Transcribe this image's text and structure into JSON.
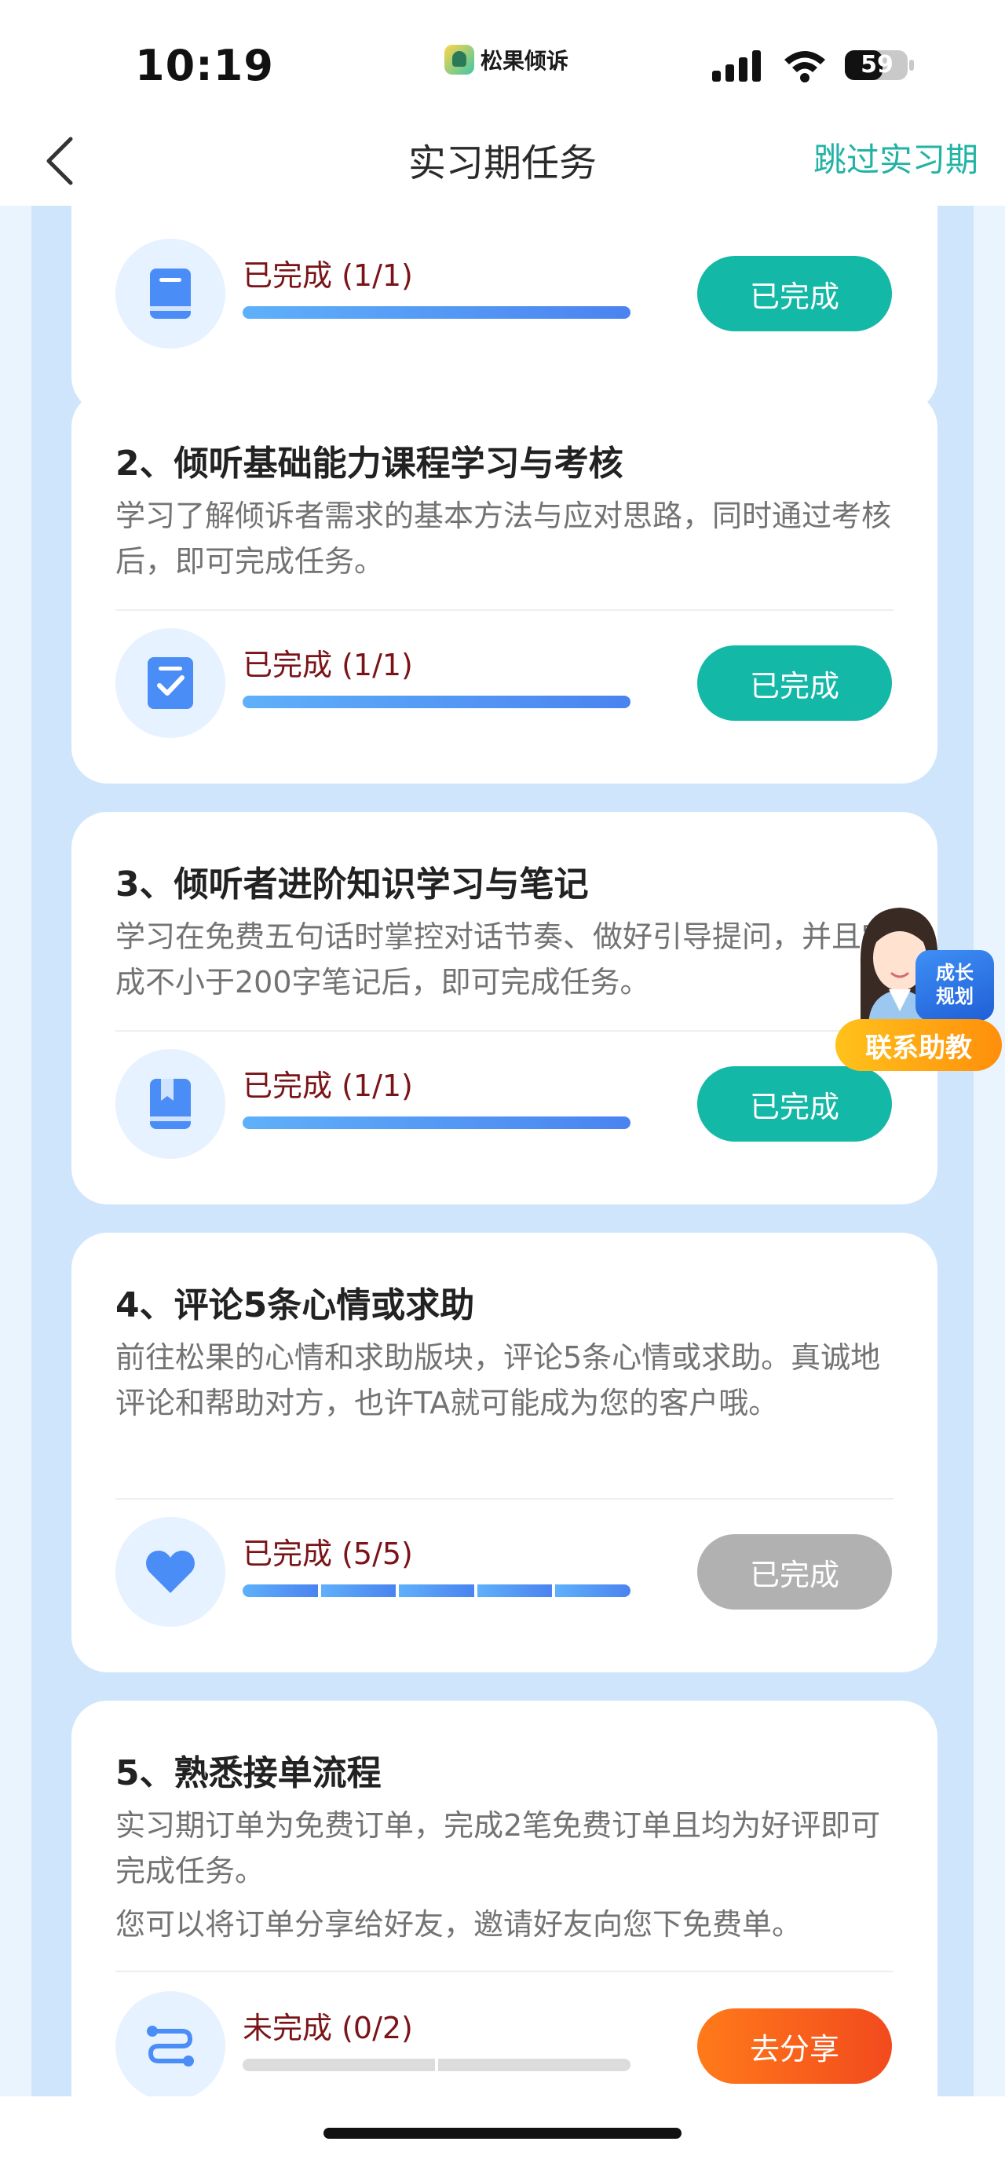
{
  "status_bar": {
    "time": "10:19",
    "brand": "松果倾诉",
    "battery": "59"
  },
  "nav": {
    "title": "实习期任务",
    "skip": "跳过实习期"
  },
  "tasks": [
    {
      "title": "",
      "description": [],
      "icon": "book-icon",
      "status": "已完成 (1/1)",
      "progress": 1,
      "button": "已完成",
      "button_style": "teal"
    },
    {
      "title": "2、倾听基础能力课程学习与考核",
      "description": [
        "学习了解倾诉者需求的基本方法与应对思路，同时通过考核后，即可完成任务。"
      ],
      "icon": "checklist-icon",
      "status": "已完成 (1/1)",
      "progress": 1,
      "button": "已完成",
      "button_style": "teal"
    },
    {
      "title": "3、倾听者进阶知识学习与笔记",
      "description": [
        "学习在免费五句话时掌控对话节奏、做好引导提问，并且完成不小于200字笔记后，即可完成任务。"
      ],
      "icon": "book-icon",
      "status": "已完成 (1/1)",
      "progress": 1,
      "button": "已完成",
      "button_style": "teal"
    },
    {
      "title": "4、评论5条心情或求助",
      "description": [
        "前往松果的心情和求助版块，评论5条心情或求助。真诚地评论和帮助对方，也许TA就可能成为您的客户哦。"
      ],
      "icon": "heart-icon",
      "status": "已完成 (5/5)",
      "progress": 1,
      "button": "已完成",
      "button_style": "gray"
    },
    {
      "title": "5、熟悉接单流程",
      "description": [
        "实习期订单为免费订单，完成2笔免费订单且均为好评即可完成任务。",
        "您可以将订单分享给好友，邀请好友向您下免费单。"
      ],
      "icon": "flow-icon",
      "status": "未完成 (0/2)",
      "progress": 0,
      "button": "去分享",
      "button_style": "orange"
    }
  ],
  "assistant": {
    "badge": "成长\n规划",
    "label": "联系助教"
  },
  "colors": {
    "accent": "#14b8a6",
    "skip_link": "#22b3a5",
    "status_text": "#7a1418",
    "progress": "#4a83f0",
    "background": "#cfe5fb"
  }
}
